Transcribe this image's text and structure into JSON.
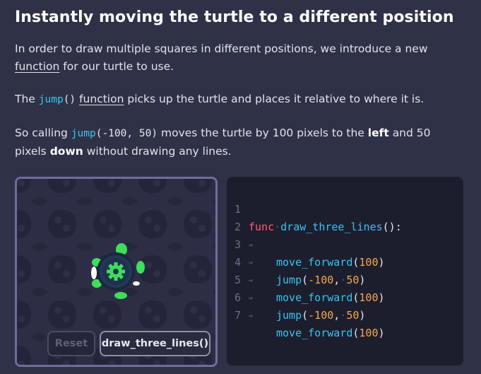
{
  "title": "Instantly moving the turtle to a different position",
  "para1": {
    "before": "In order to draw multiple squares in different positions, we introduce a new",
    "link": "function",
    "after": "for our turtle to use."
  },
  "para2": {
    "before": "The",
    "code": "jump",
    "code_parens": "()",
    "link": "function",
    "after": "picks up the turtle and places it relative to where it is."
  },
  "para3": {
    "before": "So calling",
    "code_fn": "jump",
    "code_open": "(",
    "code_arg1": "-100",
    "code_sep": ", ",
    "code_arg2": "50",
    "code_close": ")",
    "mid1": "moves the turtle by 100 pixels to the",
    "bold1": "left",
    "mid2": "and 50",
    "line2_start": "pixels",
    "bold2": "down",
    "after": "without drawing any lines."
  },
  "buttons": {
    "reset": "Reset",
    "run": "draw_three_lines()"
  },
  "code": {
    "line_numbers": [
      "1",
      "2",
      "3",
      "4",
      "5",
      "6",
      "7"
    ],
    "tab_mark": "⇥",
    "space_dot": "·",
    "l1": {
      "kw": "func",
      "name": "draw_three_lines",
      "punc": "():"
    },
    "l2": {
      "fn": "move_forward",
      "open": "(",
      "arg": "100",
      "close": ")"
    },
    "l3": {
      "fn": "jump",
      "open": "(",
      "arg1": "-100",
      "comma": ",",
      "arg2": "50",
      "close": ")"
    },
    "l4": {
      "fn": "move_forward",
      "open": "(",
      "arg": "100",
      "close": ")"
    },
    "l5": {
      "fn": "jump",
      "open": "(",
      "arg1": "-100",
      "comma": ",",
      "arg2": "50",
      "close": ")"
    },
    "l6": {
      "fn": "move_forward",
      "open": "(",
      "arg": "100",
      "close": ")"
    }
  },
  "colors": {
    "background": "#2f3247",
    "panel_border": "#6f6d9e",
    "code_bg": "#1d1e2d",
    "keyword": "#ff5a79",
    "function": "#38c4f2",
    "number": "#f6a84b",
    "turtle_green": "#3ddf5a"
  },
  "icons": {
    "turtle": "turtle-icon",
    "gear": "gear-icon"
  }
}
